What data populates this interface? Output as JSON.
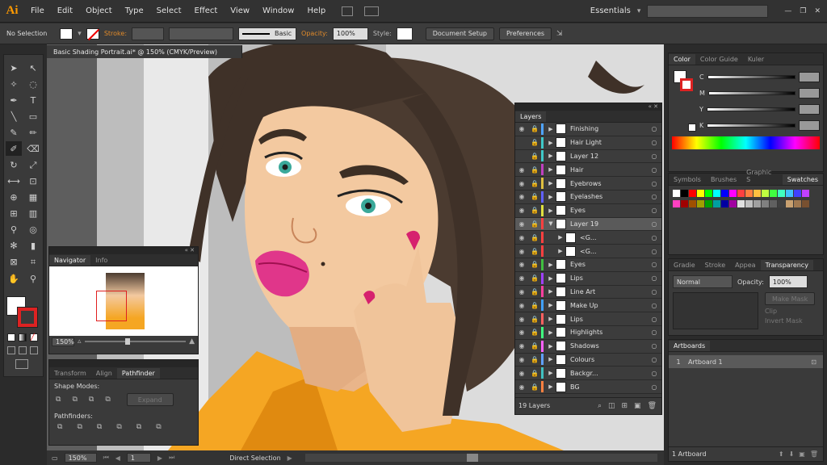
{
  "app": {
    "logo": "Ai"
  },
  "menu": [
    "File",
    "Edit",
    "Object",
    "Type",
    "Select",
    "Effect",
    "View",
    "Window",
    "Help"
  ],
  "workspace": "Essentials",
  "control": {
    "selection": "No Selection",
    "stroke_label": "Stroke:",
    "brush": "Basic",
    "opacity_label": "Opacity:",
    "opacity": "100%",
    "style_label": "Style:",
    "doc_setup": "Document Setup",
    "preferences": "Preferences"
  },
  "document": {
    "tab": "Basic Shading Portrait.ai* @ 150% (CMYK/Preview)"
  },
  "navigator": {
    "tabs": [
      "Navigator",
      "Info"
    ],
    "zoom": "150%"
  },
  "pathfinder": {
    "tabs": [
      "Transform",
      "Align",
      "Pathfinder"
    ],
    "shape_modes": "Shape Modes:",
    "expand": "Expand",
    "pathfinders": "Pathfinders:"
  },
  "layers": {
    "title": "Layers",
    "count": "19 Layers",
    "items": [
      {
        "name": "Finishing",
        "color": "#4fa3ff",
        "expand": "▶",
        "eye": "◉"
      },
      {
        "name": "Hair Light",
        "color": "#3fc8c8",
        "expand": "▶",
        "eye": ""
      },
      {
        "name": "Layer 12",
        "color": "#3fc8c8",
        "expand": "▶",
        "eye": ""
      },
      {
        "name": "Hair",
        "color": "#c040c0",
        "expand": "▶",
        "eye": "◉"
      },
      {
        "name": "Eyebrows",
        "color": "#e0c040",
        "expand": "▶",
        "eye": "◉"
      },
      {
        "name": "Eyelashes",
        "color": "#6060ff",
        "expand": "▶",
        "eye": "◉"
      },
      {
        "name": "Eyes",
        "color": "#e0e040",
        "expand": "▶",
        "eye": "◉"
      },
      {
        "name": "Layer 19",
        "color": "#ff4040",
        "expand": "▼",
        "eye": "◉"
      },
      {
        "name": "<G...",
        "color": "#ff4040",
        "expand": "▶",
        "eye": "◉"
      },
      {
        "name": "<G...",
        "color": "#ff4040",
        "expand": "▶",
        "eye": "◉"
      },
      {
        "name": "Eyes",
        "color": "#40c040",
        "expand": "▶",
        "eye": "◉"
      },
      {
        "name": "Lips",
        "color": "#a040ff",
        "expand": "▶",
        "eye": "◉"
      },
      {
        "name": "Line Art",
        "color": "#ff40a0",
        "expand": "▶",
        "eye": "◉"
      },
      {
        "name": "Make Up",
        "color": "#40a0ff",
        "expand": "▶",
        "eye": "◉"
      },
      {
        "name": "Lips",
        "color": "#ff6060",
        "expand": "▶",
        "eye": "◉"
      },
      {
        "name": "Highlights",
        "color": "#40ff80",
        "expand": "▶",
        "eye": "◉"
      },
      {
        "name": "Shadows",
        "color": "#ff60ff",
        "expand": "▶",
        "eye": "◉"
      },
      {
        "name": "Colours",
        "color": "#60a0ff",
        "expand": "▶",
        "eye": "◉"
      },
      {
        "name": "Backgr...",
        "color": "#40c0c0",
        "expand": "▶",
        "eye": "◉"
      },
      {
        "name": "BG",
        "color": "#ff8040",
        "expand": "▶",
        "eye": "◉"
      }
    ]
  },
  "color_panel": {
    "tabs": [
      "Color",
      "Color Guide",
      "Kuler"
    ],
    "channels": [
      "C",
      "M",
      "Y",
      "K"
    ]
  },
  "swatches": {
    "tabs": [
      "Symbols",
      "Brushes",
      "Graphic S",
      "Swatches"
    ],
    "colors": [
      "#ffffff",
      "#000000",
      "#ff0000",
      "#ffff00",
      "#00ff00",
      "#00ffff",
      "#0000ff",
      "#ff00ff",
      "#ff4040",
      "#ff8040",
      "#ffc040",
      "#c0ff40",
      "#40ff40",
      "#40ffc0",
      "#40c0ff",
      "#4040ff",
      "#c040ff",
      "#ff40c0",
      "#a00000",
      "#a05000",
      "#a0a000",
      "#00a000",
      "#00a0a0",
      "#0000a0",
      "#a000a0",
      "#e0e0e0",
      "#c0c0c0",
      "#a0a0a0",
      "#808080",
      "#606060",
      "#404040",
      "#c8a070",
      "#a07850",
      "#785030"
    ]
  },
  "transparency": {
    "tabs": [
      "Gradie",
      "Stroke",
      "Appea",
      "Transparency"
    ],
    "mode": "Normal",
    "opacity_label": "Opacity:",
    "opacity": "100%",
    "make_mask": "Make Mask",
    "clip": "Clip",
    "invert_mask": "Invert Mask"
  },
  "artboards": {
    "title": "Artboards",
    "item_index": "1",
    "item_name": "Artboard 1",
    "count": "1 Artboard"
  },
  "status": {
    "zoom": "150%",
    "page": "1",
    "tool": "Direct Selection"
  }
}
